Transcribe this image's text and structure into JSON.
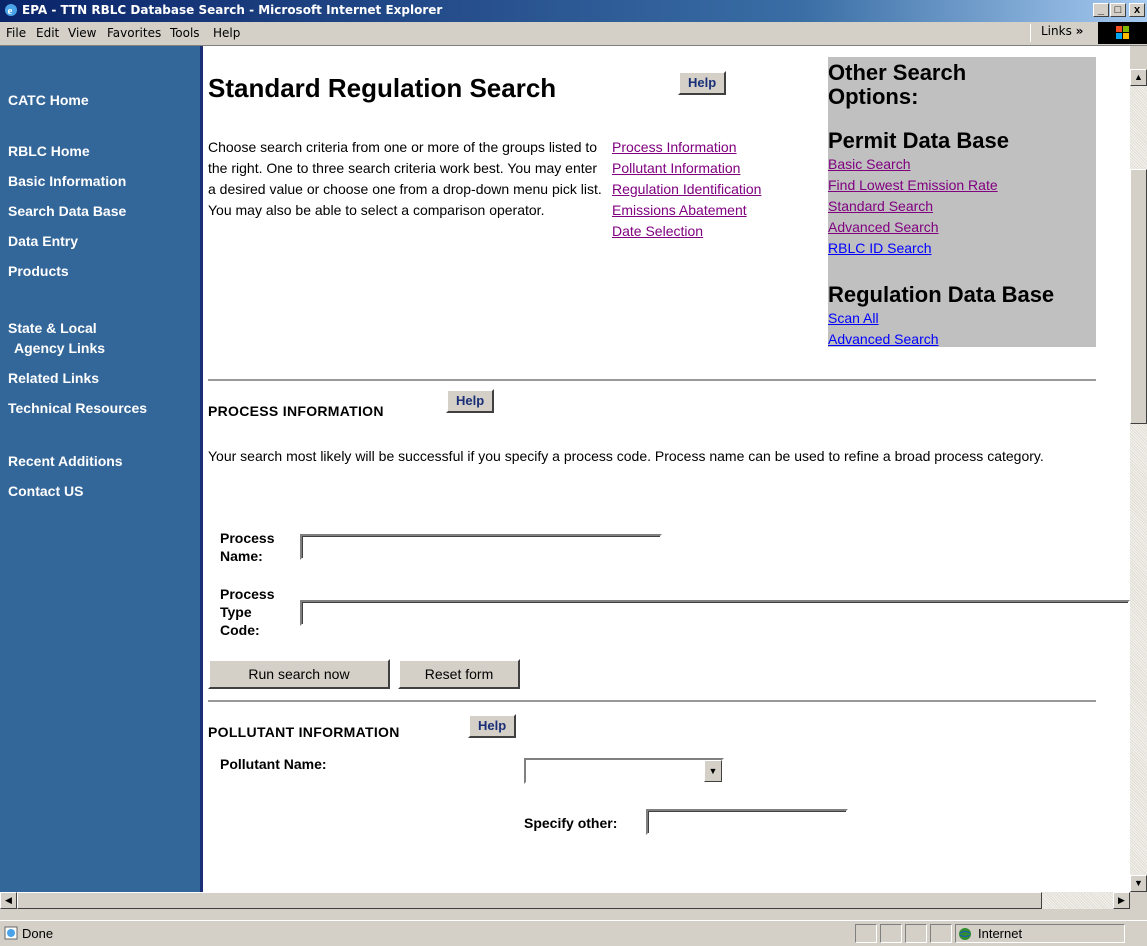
{
  "window": {
    "title": "EPA - TTN RBLC Database Search - Microsoft Internet Explorer",
    "controls": [
      "_",
      "□",
      "x"
    ]
  },
  "menu": {
    "items": [
      "File",
      "Edit",
      "View",
      "Favorites",
      "Tools",
      "Help"
    ],
    "links_label": "Links"
  },
  "sidebar": {
    "items": [
      "CATC Home",
      "RBLC Home",
      "Basic Information",
      "Search Data Base",
      "Data Entry",
      "Products",
      "State & Local",
      "Agency Links",
      "Related Links",
      "Technical Resources",
      "Recent Additions",
      "Contact US"
    ]
  },
  "main": {
    "title": "Standard Regulation Search",
    "help_label": "Help",
    "intro": "Choose search criteria from one or more of the groups listed to the right. One to three search criteria work best. You may enter a desired value or choose one from a drop-down menu pick list. You may also be able to select a comparison operator.",
    "section_links": [
      "Process Information",
      "Pollutant Information",
      "Regulation Identification",
      "Emissions Abatement",
      "Date Selection"
    ]
  },
  "other_search": {
    "heading_line1": "Other Search",
    "heading_line2": "Options:",
    "permit_heading": "Permit Data Base",
    "permit_links": [
      "Basic Search",
      "Find Lowest Emission Rate",
      "Standard Search",
      "Advanced Search",
      "RBLC ID Search"
    ],
    "regulation_heading": "Regulation Data Base",
    "regulation_links": [
      "Scan All",
      "Advanced Search"
    ]
  },
  "process_section": {
    "heading": "PROCESS INFORMATION",
    "help_label": "Help",
    "description": "Your search most likely will be successful if you specify a process code. Process name can be used to refine a broad process category.",
    "process_name_label_1": "Process",
    "process_name_label_2": "Name:",
    "process_name_value": "",
    "type_code_label_1": "Process",
    "type_code_label_2": "Type",
    "type_code_label_3": "Code:",
    "type_code_value": "",
    "run_button": "Run search now",
    "reset_button": "Reset form"
  },
  "pollutant_section": {
    "heading": "POLLUTANT INFORMATION",
    "help_label": "Help",
    "pollutant_name_label": "Pollutant Name:",
    "pollutant_selected": "",
    "specify_other_label": "Specify other:",
    "specify_other_value": ""
  },
  "status": {
    "text": "Done",
    "zone": "Internet"
  }
}
